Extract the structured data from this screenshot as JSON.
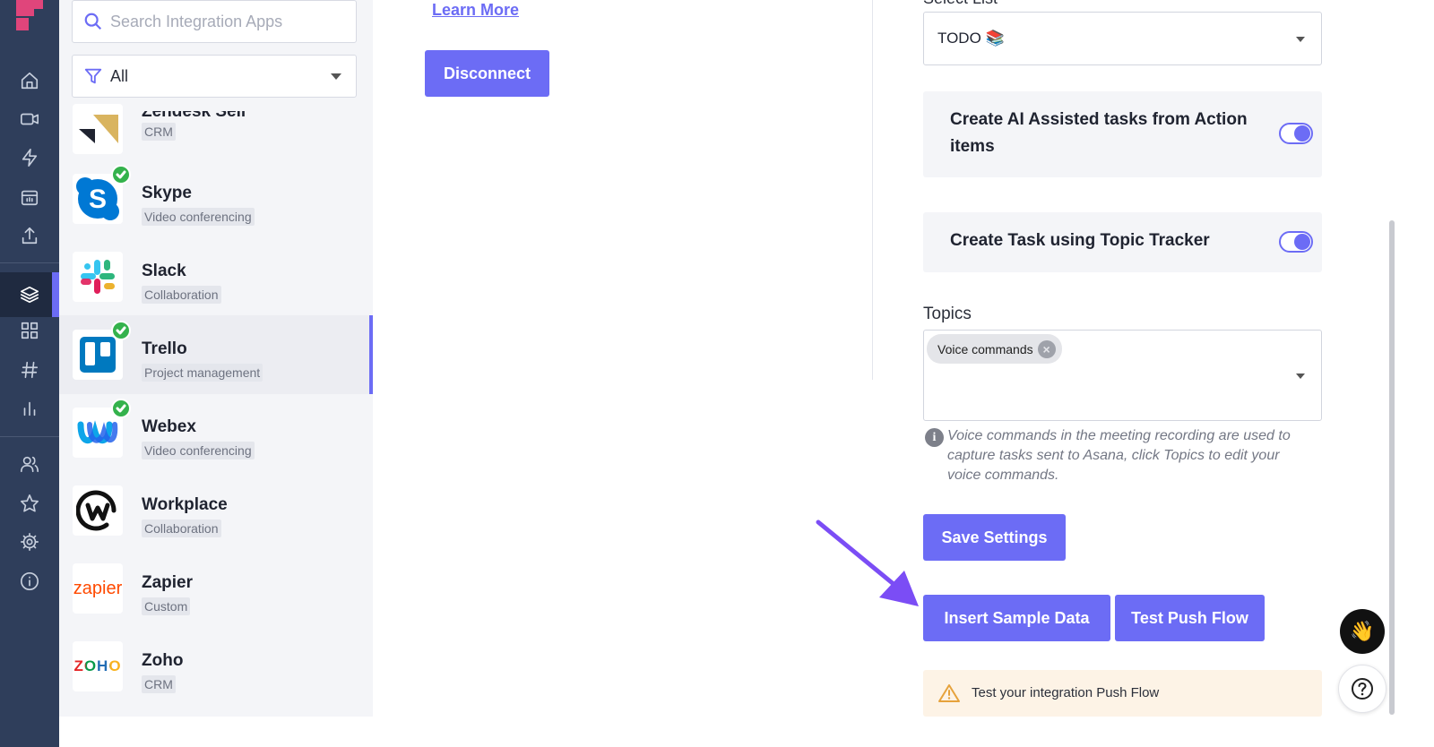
{
  "sidebar": {
    "icons": [
      "home-icon",
      "video-icon",
      "bolt-icon",
      "calendar-icon",
      "upload-icon",
      "layers-icon",
      "grid-icon",
      "hashtag-icon",
      "bar-chart-icon",
      "users-icon",
      "star-icon",
      "gear-icon",
      "info-icon"
    ],
    "active": "layers-icon",
    "accent": "#6c6cf5"
  },
  "apps_panel": {
    "search_placeholder": "Search Integration Apps",
    "filter_value": "All",
    "apps": [
      {
        "name": "Zendesk Sell",
        "category": "CRM",
        "connected": false
      },
      {
        "name": "Skype",
        "category": "Video conferencing",
        "connected": true
      },
      {
        "name": "Slack",
        "category": "Collaboration",
        "connected": false
      },
      {
        "name": "Trello",
        "category": "Project management",
        "connected": true,
        "selected": true
      },
      {
        "name": "Webex",
        "category": "Video conferencing",
        "connected": true
      },
      {
        "name": "Workplace",
        "category": "Collaboration",
        "connected": false
      },
      {
        "name": "Zapier",
        "category": "Custom",
        "connected": false,
        "logo_text": "zapier"
      },
      {
        "name": "Zoho",
        "category": "CRM",
        "connected": false,
        "logo_text": "ZOHO"
      }
    ]
  },
  "main": {
    "learn_more": "Learn More",
    "disconnect_label": "Disconnect"
  },
  "settings": {
    "list_label": "Select List",
    "list_value": "TODO 📚",
    "toggle_ai_label": "Create AI Assisted tasks from Action items",
    "toggle_topic_label": "Create Task using Topic Tracker",
    "topics_label": "Topics",
    "topic_chip": "Voice commands",
    "info_text": "Voice commands in the meeting recording are used to capture tasks sent to Asana, click Topics to edit your voice commands.",
    "save_label": "Save Settings",
    "insert_label": "Insert Sample Data",
    "test_label": "Test Push Flow",
    "notice_text": "Test your integration Push Flow"
  },
  "floating": {
    "wave_emoji": "👋",
    "help_icon": "question-circle-icon"
  }
}
